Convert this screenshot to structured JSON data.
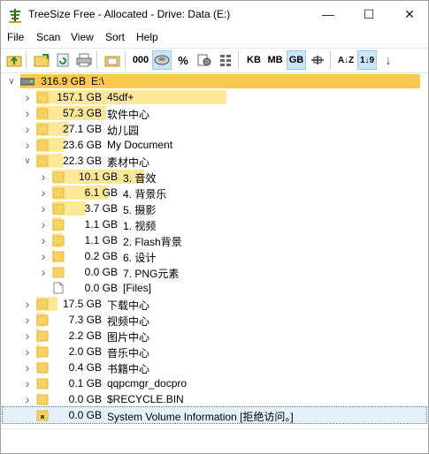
{
  "window": {
    "title": "TreeSize Free - Allocated - Drive: Data (E:)",
    "min_glyph": "—",
    "max_glyph": "☐",
    "close_glyph": "✕"
  },
  "menu": [
    "File",
    "Scan",
    "View",
    "Sort",
    "Help"
  ],
  "toolbar": {
    "unit_kb": "KB",
    "unit_mb": "MB",
    "unit_gb": "GB",
    "percent": "%",
    "digits": "000",
    "sort_az": "A↓Z",
    "sort_19": "1↓9",
    "arrow_down": "↓",
    "active_unit": "GB"
  },
  "colors": {
    "root_bar": "#f9c94e",
    "bar": "#fde89a",
    "folder": "#f5d263",
    "folder_dark": "#e6b73a"
  },
  "tree": [
    {
      "level": 0,
      "expander": "open",
      "icon": "drive",
      "size": "316.9 GB",
      "name": "E:\\",
      "fraction": 1.0
    },
    {
      "level": 1,
      "expander": "closed",
      "icon": "folder",
      "size": "157.1 GB",
      "name": "45df+",
      "fraction": 0.496
    },
    {
      "level": 1,
      "expander": "closed",
      "icon": "folder",
      "size": "57.3 GB",
      "name": "软件中心",
      "fraction": 0.181
    },
    {
      "level": 1,
      "expander": "closed",
      "icon": "folder",
      "size": "27.1 GB",
      "name": "幼儿园",
      "fraction": 0.086
    },
    {
      "level": 1,
      "expander": "closed",
      "icon": "folder",
      "size": "23.6 GB",
      "name": "My Document",
      "fraction": 0.074
    },
    {
      "level": 1,
      "expander": "open",
      "icon": "folder",
      "size": "22.3 GB",
      "name": "素材中心",
      "fraction": 0.07
    },
    {
      "level": 2,
      "expander": "closed",
      "icon": "folder",
      "size": "10.1 GB",
      "name": "3. 音效",
      "fraction": 0.453
    },
    {
      "level": 2,
      "expander": "closed",
      "icon": "folder",
      "size": "6.1 GB",
      "name": "4. 背景乐",
      "fraction": 0.274
    },
    {
      "level": 2,
      "expander": "closed",
      "icon": "folder",
      "size": "3.7 GB",
      "name": "5. 摄影",
      "fraction": 0.166
    },
    {
      "level": 2,
      "expander": "closed",
      "icon": "folder",
      "size": "1.1 GB",
      "name": "1. 视频",
      "fraction": 0.049
    },
    {
      "level": 2,
      "expander": "closed",
      "icon": "folder",
      "size": "1.1 GB",
      "name": "2. Flash背景",
      "fraction": 0.049
    },
    {
      "level": 2,
      "expander": "closed",
      "icon": "folder",
      "size": "0.2 GB",
      "name": "6. 设计",
      "fraction": 0.009
    },
    {
      "level": 2,
      "expander": "closed",
      "icon": "folder",
      "size": "0.0 GB",
      "name": "7. PNG元素",
      "fraction": 0.0
    },
    {
      "level": 2,
      "expander": "none",
      "icon": "file",
      "size": "0.0 GB",
      "name": "[Files]",
      "fraction": 0.0
    },
    {
      "level": 1,
      "expander": "closed",
      "icon": "folder",
      "size": "17.5 GB",
      "name": "下载中心",
      "fraction": 0.055
    },
    {
      "level": 1,
      "expander": "closed",
      "icon": "folder",
      "size": "7.3 GB",
      "name": "视频中心",
      "fraction": 0.023
    },
    {
      "level": 1,
      "expander": "closed",
      "icon": "folder",
      "size": "2.2 GB",
      "name": "图片中心",
      "fraction": 0.007
    },
    {
      "level": 1,
      "expander": "closed",
      "icon": "folder",
      "size": "2.0 GB",
      "name": "音乐中心",
      "fraction": 0.006
    },
    {
      "level": 1,
      "expander": "closed",
      "icon": "folder",
      "size": "0.4 GB",
      "name": "书籍中心",
      "fraction": 0.001
    },
    {
      "level": 1,
      "expander": "closed",
      "icon": "folder",
      "size": "0.1 GB",
      "name": "qqpcmgr_docpro",
      "fraction": 0.0
    },
    {
      "level": 1,
      "expander": "closed",
      "icon": "folder",
      "size": "0.0 GB",
      "name": "$RECYCLE.BIN",
      "fraction": 0.0
    },
    {
      "level": 1,
      "expander": "none",
      "icon": "folder-lock",
      "size": "0.0 GB",
      "name": "System Volume Information  [拒绝访问。]",
      "fraction": 0.0,
      "selected": true
    }
  ]
}
